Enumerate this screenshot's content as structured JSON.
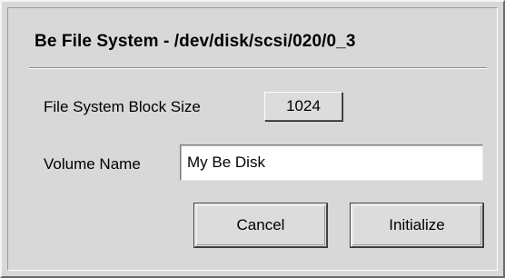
{
  "dialog": {
    "title": "Be File System - /dev/disk/scsi/020/0_3"
  },
  "form": {
    "block_size_label": "File System Block Size",
    "block_size_value": "1024",
    "volume_name_label": "Volume Name",
    "volume_name_value": "My Be Disk"
  },
  "buttons": {
    "cancel_label": "Cancel",
    "initialize_label": "Initialize"
  },
  "colors": {
    "dialog_background": "#d8d8d8",
    "field_background": "#ffffff"
  }
}
